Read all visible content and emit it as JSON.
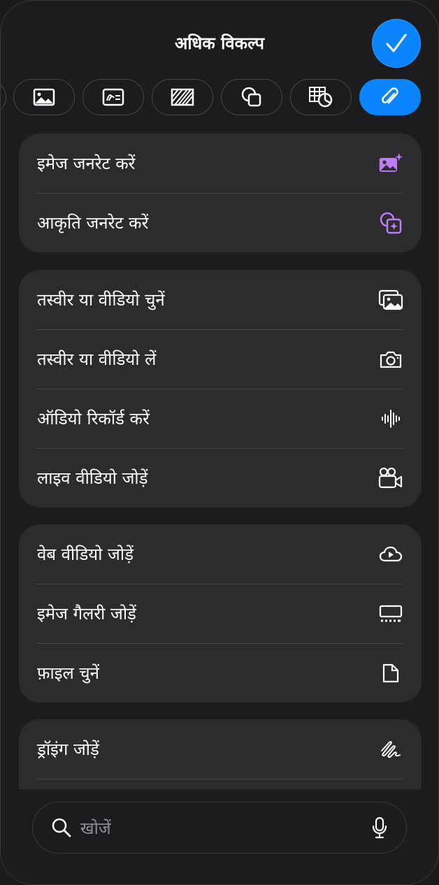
{
  "header": {
    "title": "अधिक विकल्प",
    "done_icon": "checkmark-icon"
  },
  "tabs": [
    {
      "icon": "partial-tab-icon"
    },
    {
      "icon": "image-icon"
    },
    {
      "icon": "photo-gallery-icon"
    },
    {
      "icon": "striped-rectangle-icon"
    },
    {
      "icon": "shapes-icon"
    },
    {
      "icon": "table-chart-icon"
    },
    {
      "icon": "paperclip-icon",
      "active": true
    }
  ],
  "groups": [
    {
      "items": [
        {
          "label": "इमेज जनरेट करें",
          "icon": "image-sparkle-icon"
        },
        {
          "label": "आकृति जनरेट करें",
          "icon": "shape-sparkle-icon"
        }
      ]
    },
    {
      "items": [
        {
          "label": "तस्वीर या वीडियो चुनें",
          "icon": "photos-icon"
        },
        {
          "label": "तस्वीर या वीडियो लें",
          "icon": "camera-icon"
        },
        {
          "label": "ऑडियो रिकॉर्ड करें",
          "icon": "waveform-icon"
        },
        {
          "label": "लाइव वीडियो जोड़ें",
          "icon": "video-camera-icon"
        }
      ]
    },
    {
      "items": [
        {
          "label": "वेब वीडियो जोड़ें",
          "icon": "cloud-play-icon"
        },
        {
          "label": "इमेज गैलरी जोड़ें",
          "icon": "gallery-icon"
        },
        {
          "label": "फ़ाइल चुनें",
          "icon": "document-icon"
        }
      ]
    },
    {
      "items": [
        {
          "label": "ड्रॉइंग जोड़ें",
          "icon": "scribble-icon"
        }
      ]
    }
  ],
  "search": {
    "placeholder": "खोजें",
    "icon": "search-icon",
    "mic_icon": "microphone-icon"
  },
  "colors": {
    "accent": "#0a84ff",
    "ai_purple": "#bf7cf7",
    "background": "#1c1c1e",
    "card": "#2c2c2e"
  }
}
